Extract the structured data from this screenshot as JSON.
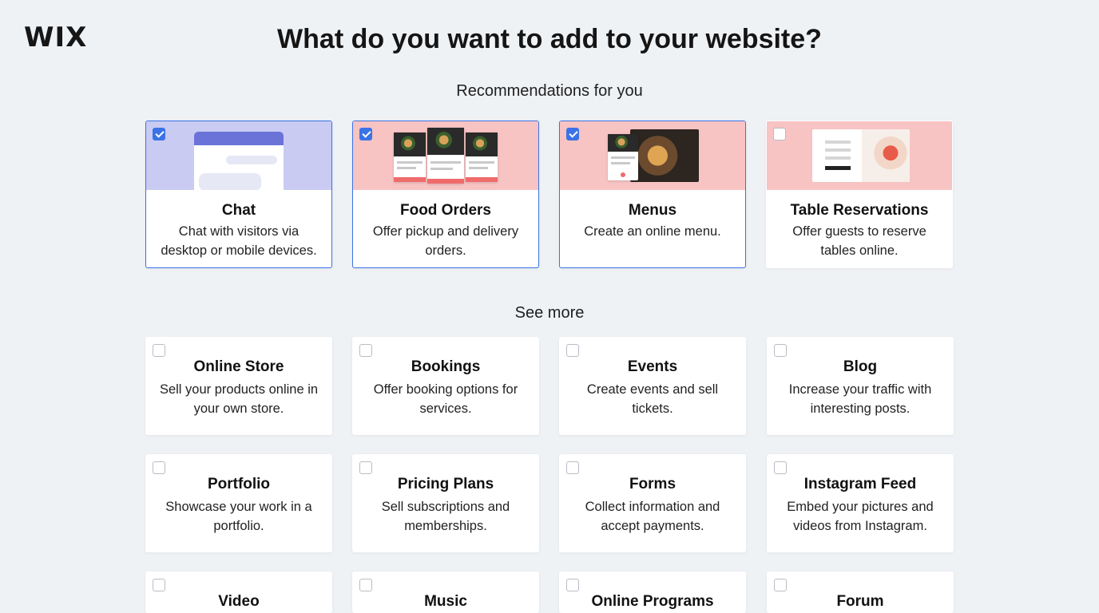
{
  "brand": {
    "logo_text": "WIX"
  },
  "header": {
    "title": "What do you want to add to your website?"
  },
  "recommended": {
    "heading": "Recommendations for you",
    "items": [
      {
        "title": "Chat",
        "desc": "Chat with visitors via desktop or mobile devices.",
        "checked": true,
        "thumb_color": "#c9cbf2",
        "icon": "chat-thumbnail"
      },
      {
        "title": "Food Orders",
        "desc": "Offer pickup and delivery orders.",
        "checked": true,
        "thumb_color": "#f7c3c3",
        "icon": "food-orders-thumbnail"
      },
      {
        "title": "Menus",
        "desc": "Create an online menu.",
        "checked": true,
        "thumb_color": "#f7c3c3",
        "icon": "menus-thumbnail"
      },
      {
        "title": "Table Reservations",
        "desc": "Offer guests to reserve tables online.",
        "checked": false,
        "thumb_color": "#f7c3c3",
        "icon": "table-reservations-thumbnail"
      }
    ]
  },
  "more": {
    "heading": "See more",
    "items": [
      {
        "title": "Online Store",
        "desc": "Sell your products online in your own store.",
        "checked": false
      },
      {
        "title": "Bookings",
        "desc": "Offer booking options for services.",
        "checked": false
      },
      {
        "title": "Events",
        "desc": "Create events and sell tickets.",
        "checked": false
      },
      {
        "title": "Blog",
        "desc": "Increase your traffic with interesting posts.",
        "checked": false
      },
      {
        "title": "Portfolio",
        "desc": "Showcase your work in a portfolio.",
        "checked": false
      },
      {
        "title": "Pricing Plans",
        "desc": "Sell subscriptions and memberships.",
        "checked": false
      },
      {
        "title": "Forms",
        "desc": "Collect information and accept payments.",
        "checked": false
      },
      {
        "title": "Instagram Feed",
        "desc": "Embed your pictures and videos from Instagram.",
        "checked": false
      },
      {
        "title": "Video",
        "desc": "",
        "checked": false
      },
      {
        "title": "Music",
        "desc": "",
        "checked": false
      },
      {
        "title": "Online Programs",
        "desc": "",
        "checked": false
      },
      {
        "title": "Forum",
        "desc": "",
        "checked": false
      }
    ]
  },
  "colors": {
    "accent": "#3b73e6",
    "background": "#eff2f5",
    "thumb_purple": "#c9cbf2",
    "thumb_pink": "#f7c3c3"
  }
}
